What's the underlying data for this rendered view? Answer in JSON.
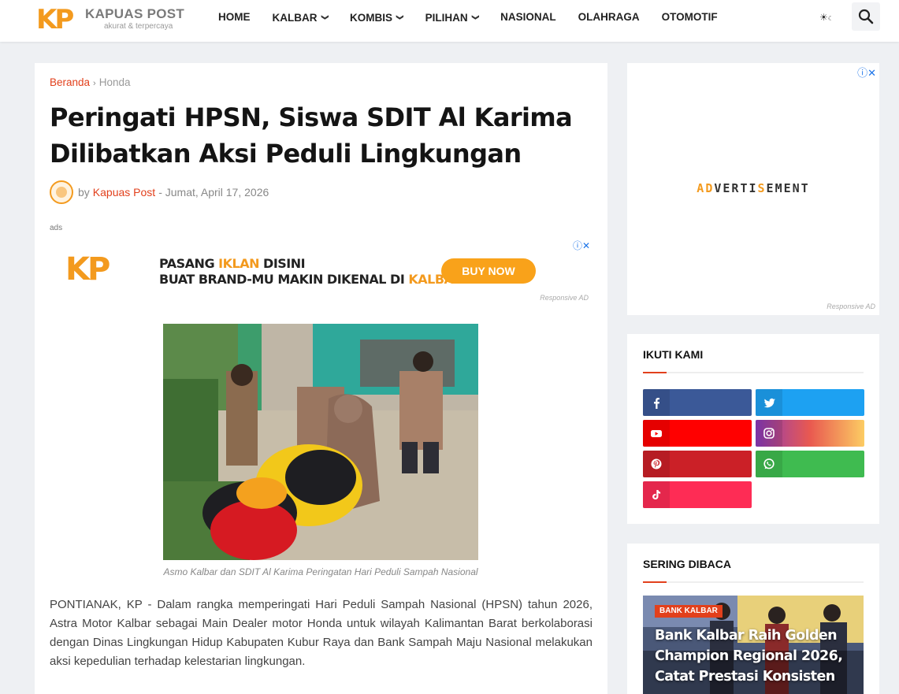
{
  "header": {
    "logo_mark": "KP",
    "logo_name": "KAPUAS POST",
    "logo_tagline": "akurat & terpercaya",
    "nav": [
      {
        "label": "HOME",
        "dropdown": false
      },
      {
        "label": "KALBAR",
        "dropdown": true
      },
      {
        "label": "KOMBIS",
        "dropdown": true
      },
      {
        "label": "PILIHAN",
        "dropdown": true
      },
      {
        "label": "NASIONAL",
        "dropdown": false
      },
      {
        "label": "OLAHRAGA",
        "dropdown": false
      },
      {
        "label": "OTOMOTIF",
        "dropdown": false
      }
    ],
    "theme_toggle": "☀",
    "search_icon": "search-icon"
  },
  "article": {
    "breadcrumb_home": "Beranda",
    "breadcrumb_category": "Honda",
    "title": "Peringati HPSN, Siswa SDIT Al Karima Dilibatkan Aksi Peduli Lingkungan",
    "by": "by",
    "author": "Kapuas Post",
    "date": "- Jumat, April 17, 2026",
    "ads_label": "ads",
    "ad": {
      "mark": "KP",
      "line1_pre": "PASANG ",
      "line1_hl": "IKLAN",
      "line1_post": " DISINI",
      "line2_pre": "BUAT BRAND-MU MAKIN DIKENAL DI ",
      "line2_hl": "KALBAR",
      "button": "BUY NOW",
      "responsive": "Responsive AD",
      "adchoice": "ⓘ✕"
    },
    "caption": "Asmo Kalbar dan SDIT Al Karima Peringatan Hari Peduli Sampah Nasional",
    "body": "PONTIANAK, KP - Dalam rangka memperingati Hari Peduli Sampah Nasional (HPSN) tahun 2026, Astra Motor Kalbar sebagai Main Dealer motor Honda untuk wilayah Kalimantan Barat berkolaborasi dengan Dinas Lingkungan Hidup Kabupaten Kubur Raya dan Bank Sampah Maju Nasional melakukan aksi kepedulian terhadap kelestarian lingkungan."
  },
  "sidebar": {
    "ad": {
      "adchoice": "ⓘ✕",
      "text_parts": [
        {
          "t": "A",
          "o": true
        },
        {
          "t": "D",
          "o": true
        },
        {
          "t": "VERTI",
          "o": false
        },
        {
          "t": "S",
          "o": true
        },
        {
          "t": "EMENT",
          "o": false
        }
      ],
      "responsive": "Responsive AD"
    },
    "follow_title": "IKUTI KAMI",
    "socials": [
      {
        "name": "facebook",
        "color": "#3b5998"
      },
      {
        "name": "twitter",
        "color": "#1da1f2"
      },
      {
        "name": "youtube",
        "color": "#ff0000"
      },
      {
        "name": "instagram",
        "color": "#c13584"
      },
      {
        "name": "pinterest",
        "color": "#cb2027"
      },
      {
        "name": "whatsapp",
        "color": "#3fbb50"
      },
      {
        "name": "tiktok",
        "color": "#fe2c55"
      }
    ],
    "popular_title": "SERING DIBACA",
    "popular": {
      "category": "BANK KALBAR",
      "title": "Bank Kalbar Raih Golden Champion Regional 2026, Catat Prestasi Konsisten"
    }
  },
  "colors": {
    "accent": "#e2401c",
    "brand": "#f39a1e"
  }
}
